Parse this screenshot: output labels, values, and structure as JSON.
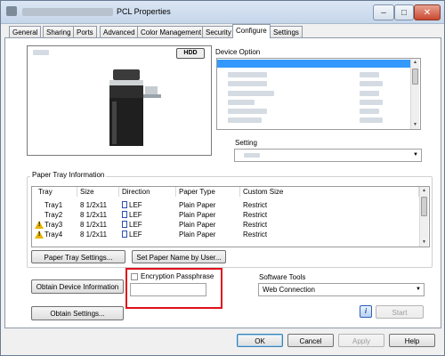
{
  "window": {
    "title": "PCL Properties",
    "buttons": {
      "minimize": "–",
      "maximize": "□",
      "close": "✕"
    }
  },
  "tabs": [
    {
      "label": "General"
    },
    {
      "label": "Sharing"
    },
    {
      "label": "Ports"
    },
    {
      "label": "Advanced"
    },
    {
      "label": "Color Management"
    },
    {
      "label": "Security"
    },
    {
      "label": "Configure"
    },
    {
      "label": "Settings"
    }
  ],
  "preview": {
    "hdd_label": "HDD"
  },
  "device_option": {
    "label": "Device Option"
  },
  "setting": {
    "label": "Setting"
  },
  "paper_tray": {
    "label": "Paper Tray Information",
    "columns": [
      "Tray",
      "Size",
      "Direction",
      "Paper Type",
      "Custom Size"
    ],
    "rows": [
      {
        "tray": "Tray1",
        "size": "8 1/2x11",
        "direction": "LEF",
        "type": "Plain Paper",
        "custom": "Restrict",
        "warning": false
      },
      {
        "tray": "Tray2",
        "size": "8 1/2x11",
        "direction": "LEF",
        "type": "Plain Paper",
        "custom": "Restrict",
        "warning": false
      },
      {
        "tray": "Tray3",
        "size": "8 1/2x11",
        "direction": "LEF",
        "type": "Plain Paper",
        "custom": "Restrict",
        "warning": true
      },
      {
        "tray": "Tray4",
        "size": "8 1/2x11",
        "direction": "LEF",
        "type": "Plain Paper",
        "custom": "Restrict",
        "warning": true
      }
    ],
    "settings_button": "Paper Tray Settings...",
    "set_paper_name_button": "Set Paper Name by User..."
  },
  "device_info": {
    "obtain_device_button": "Obtain Device Information",
    "obtain_settings_button": "Obtain Settings..."
  },
  "encryption": {
    "checkbox_label": "Encryption Passphrase",
    "value": "",
    "highlight_color": "#e0101b"
  },
  "software_tools": {
    "label": "Software Tools",
    "selected": "Web Connection",
    "start_button": "Start",
    "info_icon": "i"
  },
  "footer": {
    "ok": "OK",
    "cancel": "Cancel",
    "apply": "Apply",
    "help": "Help"
  },
  "colors": {
    "selection": "#3399ff",
    "accent": "#e0101b"
  }
}
